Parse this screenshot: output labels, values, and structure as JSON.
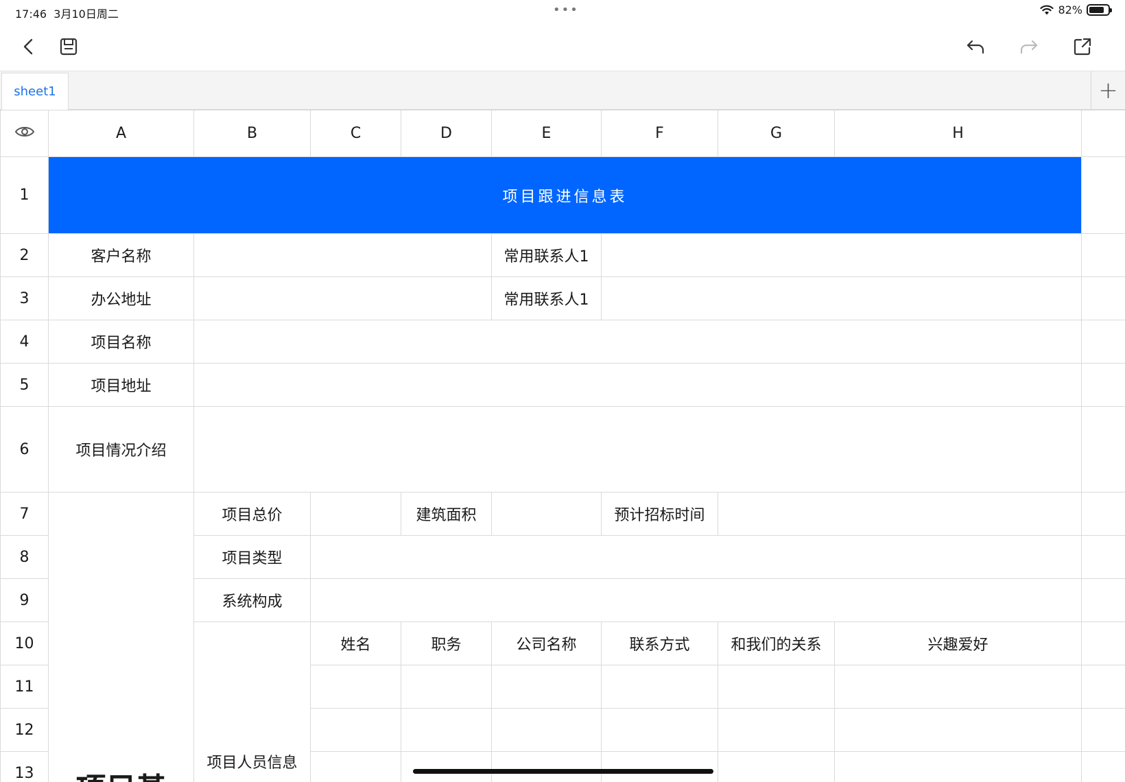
{
  "status": {
    "time": "17:46",
    "date": "3月10日周二",
    "battery": "82%",
    "battery_level": 0.82
  },
  "toolbar": {
    "back_icon": "chevron-left-icon",
    "save_icon": "save-icon",
    "undo_icon": "undo-icon",
    "redo_icon": "redo-icon",
    "share_icon": "share-icon"
  },
  "tabs": {
    "sheet1": "sheet1",
    "add": "+"
  },
  "columns": [
    "A",
    "B",
    "C",
    "D",
    "E",
    "F",
    "G",
    "H"
  ],
  "rows": [
    "1",
    "2",
    "3",
    "4",
    "5",
    "6",
    "7",
    "8",
    "9",
    "10",
    "11",
    "12",
    "13"
  ],
  "cells": {
    "title": "项目跟进信息表",
    "customer_name": "客户名称",
    "contact1_a": "常用联系人1",
    "office_address": "办公地址",
    "contact1_b": "常用联系人1",
    "project_name": "项目名称",
    "project_address": "项目地址",
    "project_intro": "项目情况介绍",
    "total_price": "项目总价",
    "building_area": "建筑面积",
    "bid_time": "预计招标时间",
    "project_type": "项目类型",
    "system_composition": "系统构成",
    "personnel_info": "项目人员信息",
    "h_name": "姓名",
    "h_position": "职务",
    "h_company": "公司名称",
    "h_contact": "联系方式",
    "h_relation": "和我们的关系",
    "h_hobby": "兴趣爱好",
    "partial_a": "项目基"
  },
  "colors": {
    "title_bg": "#0066ff",
    "accent": "#1a73e8"
  }
}
